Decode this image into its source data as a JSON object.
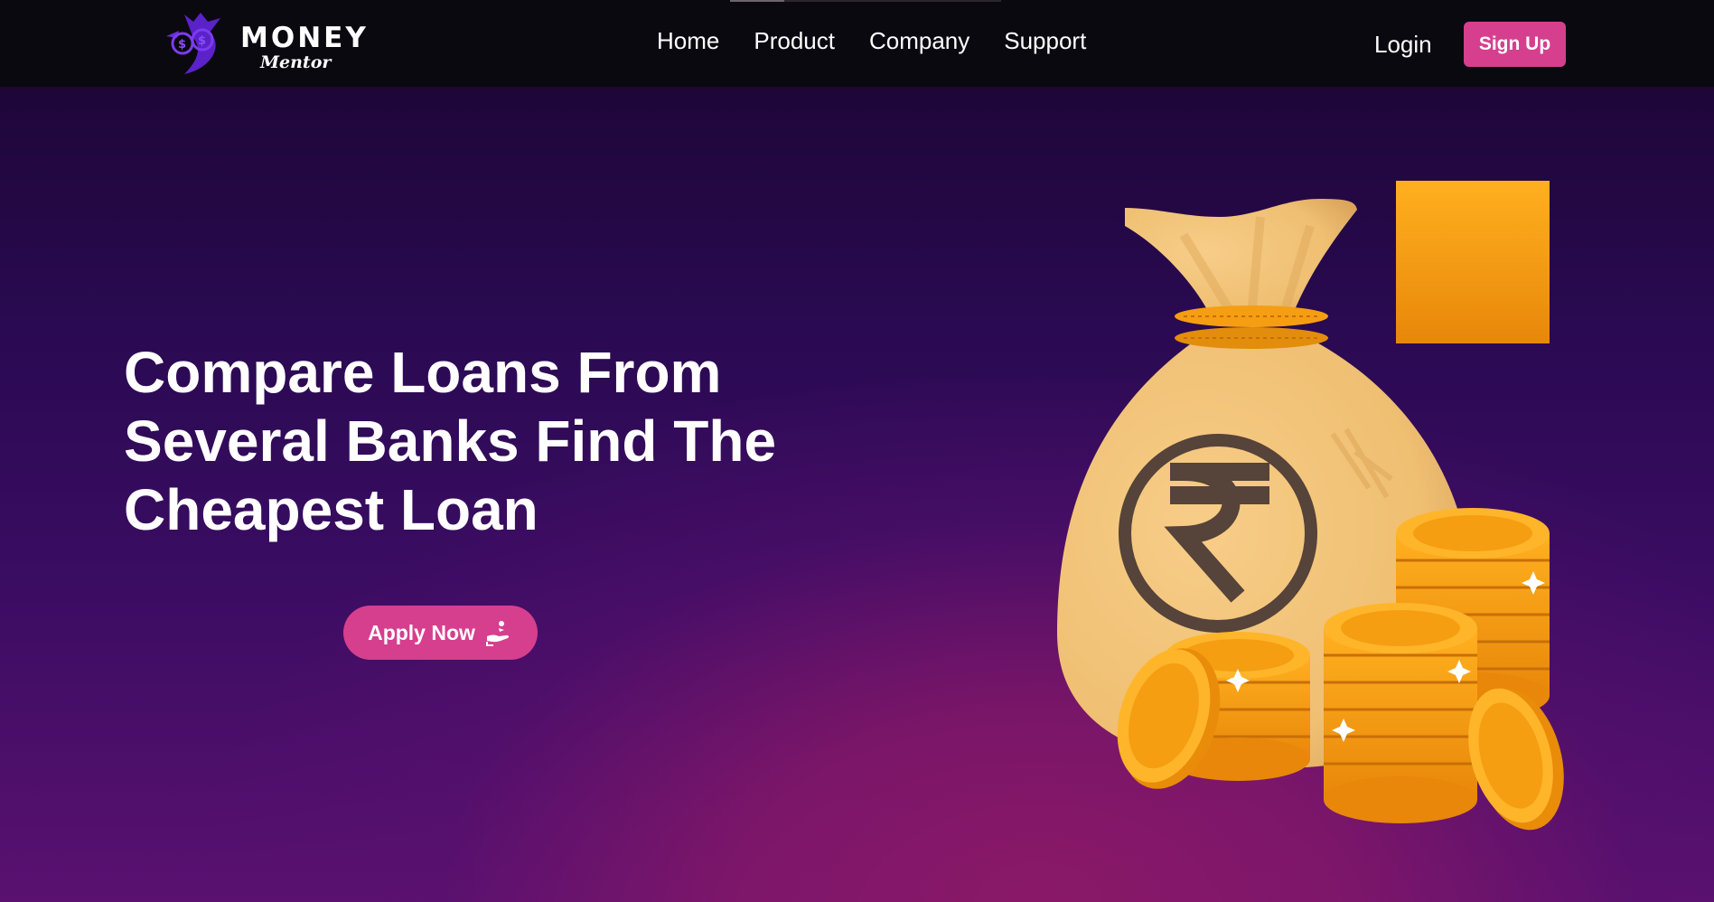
{
  "brand": {
    "line1": "MONEY",
    "line2": "Mentor"
  },
  "nav": {
    "items": [
      "Home",
      "Product",
      "Company",
      "Support"
    ]
  },
  "auth": {
    "login_label": "Login",
    "signup_label": "Sign Up"
  },
  "hero": {
    "headline_lines": [
      "Compare Loans From",
      "Several Banks Find The",
      "Cheapest Loan"
    ],
    "apply_label": "Apply Now",
    "apply_icon": "hand-coin-icon",
    "illustration": "money-bag-rupee-coins"
  },
  "colors": {
    "accent": "#d63f8e",
    "navbar": "#0b0910",
    "logo": "#6b2bd9",
    "coin": "#f5a316",
    "bag": "#f3c47c"
  }
}
